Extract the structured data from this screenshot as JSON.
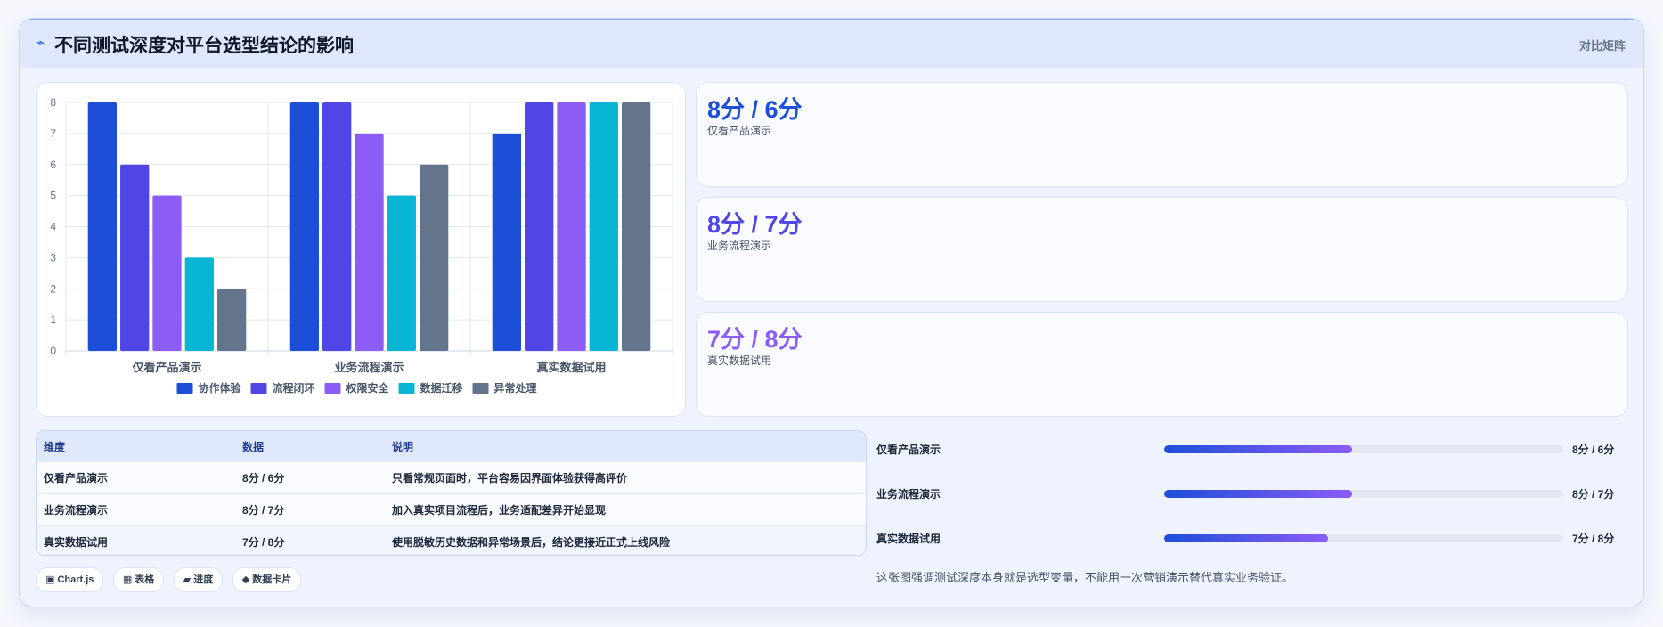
{
  "header": {
    "icon": "trend-icon",
    "icon_glyph": "⌁",
    "title": "不同测试深度对平台选型结论的影响",
    "tag": "对比矩阵"
  },
  "chart_data": {
    "type": "bar",
    "categories": [
      "仅看产品演示",
      "业务流程演示",
      "真实数据试用"
    ],
    "series": [
      {
        "name": "协作体验",
        "color": "#1d4ed8",
        "values": [
          8,
          8,
          7
        ]
      },
      {
        "name": "流程闭环",
        "color": "#4f46e5",
        "values": [
          6,
          8,
          8
        ]
      },
      {
        "name": "权限安全",
        "color": "#8b5cf6",
        "values": [
          5,
          7,
          8
        ]
      },
      {
        "name": "数据迁移",
        "color": "#06b6d4",
        "values": [
          3,
          5,
          8
        ]
      },
      {
        "name": "异常处理",
        "color": "#64748b",
        "values": [
          2,
          6,
          8
        ]
      }
    ],
    "ylim": [
      0,
      8
    ],
    "yticks": [
      "0",
      "1",
      "2",
      "3",
      "4",
      "5",
      "6",
      "7",
      "8"
    ],
    "grid": true,
    "legend_position": "bottom"
  },
  "stats": [
    {
      "value": "8分 / 6分",
      "label": "仅看产品演示",
      "color": "#1d4ed8"
    },
    {
      "value": "8分 / 7分",
      "label": "业务流程演示",
      "color": "#4f46e5"
    },
    {
      "value": "7分 / 8分",
      "label": "真实数据试用",
      "color": "#8b5cf6"
    }
  ],
  "table": {
    "headers": [
      "维度",
      "数据",
      "说明"
    ],
    "rows": [
      [
        "仅看产品演示",
        "8分 / 6分",
        "只看常规页面时，平台容易因界面体验获得高评价"
      ],
      [
        "业务流程演示",
        "8分 / 7分",
        "加入真实项目流程后，业务适配差异开始显现"
      ],
      [
        "真实数据试用",
        "7分 / 8分",
        "使用脱敏历史数据和异常场景后，结论更接近正式上线风险"
      ]
    ]
  },
  "pills": [
    {
      "icon": "chart-icon",
      "text": "▣ Chart.js"
    },
    {
      "icon": "table-icon",
      "text": "▦ 表格"
    },
    {
      "icon": "progress-icon",
      "text": "▰ 进度"
    },
    {
      "icon": "card-icon",
      "text": "◆ 数据卡片"
    }
  ],
  "progress": [
    {
      "label": "仅看产品演示",
      "text": "8分 / 6分",
      "fraction": 0.47
    },
    {
      "label": "业务流程演示",
      "text": "8分 / 7分",
      "fraction": 0.47
    },
    {
      "label": "真实数据试用",
      "text": "7分 / 8分",
      "fraction": 0.41
    }
  ],
  "note": "这张图强调测试深度本身就是选型变量，不能用一次营销演示替代真实业务验证。",
  "colors": {
    "accent": "#2563eb",
    "header_bg": "#dfe7fc",
    "card_bg": "#eef3fd"
  }
}
